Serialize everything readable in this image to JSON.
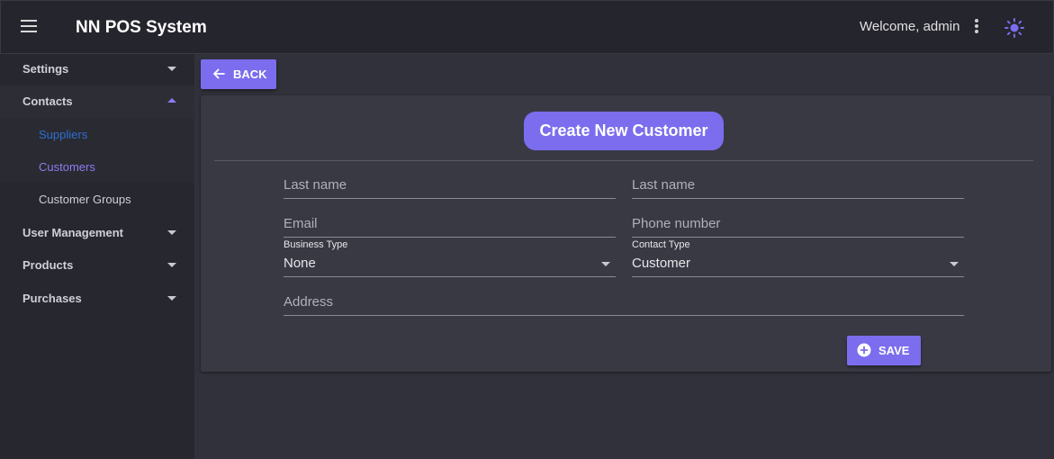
{
  "app": {
    "title": "NN POS System",
    "welcome": "Welcome, admin"
  },
  "icons": {
    "menu": "hamburger-menu-icon",
    "more": "more-vert-icon",
    "theme": "sun-icon",
    "back": "arrow-left-icon",
    "save": "plus-circle-icon"
  },
  "colors": {
    "accent": "#7b6ded",
    "active_link": "#8a7cf0",
    "suppliers_link": "#2f6fd0",
    "topbar": "#25252d",
    "sidebar": "#272730",
    "card": "#393944"
  },
  "sidebar": {
    "settings": "Settings",
    "contacts": "Contacts",
    "suppliers": "Suppliers",
    "customers": "Customers",
    "customer_groups": "Customer Groups",
    "user_management": "User Management",
    "products": "Products",
    "purchases": "Purchases"
  },
  "toolbar": {
    "back_label": "BACK"
  },
  "form": {
    "heading": "Create New Customer",
    "first_name_placeholder": "Last name",
    "last_name_placeholder": "Last name",
    "email_placeholder": "Email",
    "phone_placeholder": "Phone number",
    "business_type_label": "Business Type",
    "business_type_value": "None",
    "contact_type_label": "Contact Type",
    "contact_type_value": "Customer",
    "address_placeholder": "Address",
    "save_label": "SAVE"
  }
}
